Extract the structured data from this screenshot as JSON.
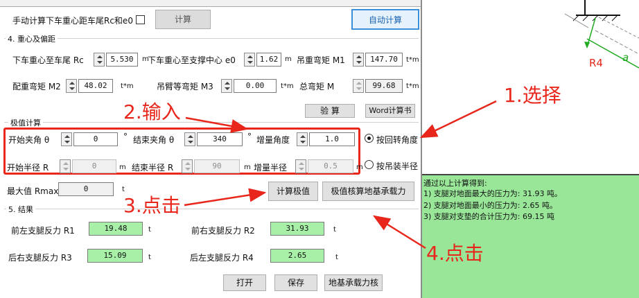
{
  "top": {
    "manual_label": "手动计算下车重心距车尾Rc和e0",
    "calc_btn": "计算",
    "auto_btn": "自动计算"
  },
  "section4": {
    "title": "4. 重心及偏距",
    "rc_label": "下车重心至车尾 Rc",
    "rc_value": "5.530",
    "rc_unit": "m",
    "e0_label": "下车重心至支撑中心 e0",
    "e0_value": "1.62",
    "e0_unit": "m",
    "m1_label": "吊重弯矩 M1",
    "m1_value": "147.70",
    "m1_unit": "t*m",
    "m2_label": "配重弯矩 M2",
    "m2_value": "48.02",
    "m2_unit": "t*m",
    "m3_label": "吊臂等弯矩 M3",
    "m3_value": "0.00",
    "m3_unit": "t*m",
    "m_label": "总弯矩 M",
    "m_value": "99.68",
    "m_unit": "t*m",
    "check_btn": "验 算",
    "word_btn": "Word计算书"
  },
  "extreme": {
    "title": "极值计算",
    "start_angle_label": "开始夹角 θ",
    "start_angle_value": "0",
    "deg1": "°",
    "end_angle_label": "结束夹角 θ",
    "end_angle_value": "340",
    "deg2": "°",
    "inc_angle_label": "增量角度",
    "inc_angle_value": "1.0",
    "start_r_label": "开始半径 R",
    "start_r_value": "0",
    "unit_m1": "m",
    "end_r_label": "结束半径 R",
    "end_r_value": "90",
    "unit_m2": "m",
    "inc_r_label": "增量半径",
    "inc_r_value": "0.5",
    "unit_m3": "m",
    "radio_angle": "按回转角度",
    "radio_radius": "按吊装半径",
    "max_label": "最大值 Rmax",
    "max_value": "0",
    "max_unit": "t",
    "calc_ext_btn": "计算极值",
    "check_ground_btn": "极值核算地基承载力"
  },
  "section5": {
    "title": "5. 结果",
    "r1_label": "前左支腿反力 R1",
    "r1_value": "19.48",
    "r2_label": "前右支腿反力 R2",
    "r2_value": "31.93",
    "r3_label": "后右支腿反力 R3",
    "r3_value": "15.09",
    "r4_label": "后左支腿反力 R4",
    "r4_value": "2.65",
    "unit_t": "t"
  },
  "bottom": {
    "open_btn": "打开",
    "save_btn": "保存",
    "ground_btn": "地基承载力核"
  },
  "result_panel": {
    "line0": "通过以上计算得到:",
    "line1": "1) 支腿对地面最大的压力为: 31.93 吨。",
    "line2": "2) 支腿对地面最小的压力为: 2.65 吨。",
    "line3": "3) 支腿对支垫的合计压力为: 69.15 吨"
  },
  "diagram": {
    "r4_label": "R4",
    "a_label": "a"
  },
  "annotations": {
    "step1": "1.选择",
    "step2": "2.输入",
    "step3": "3.点击",
    "step4": "4.点击"
  },
  "colors": {
    "accent_red": "#e8261b",
    "result_green": "#99e699",
    "value_green": "#a8f0a8"
  }
}
